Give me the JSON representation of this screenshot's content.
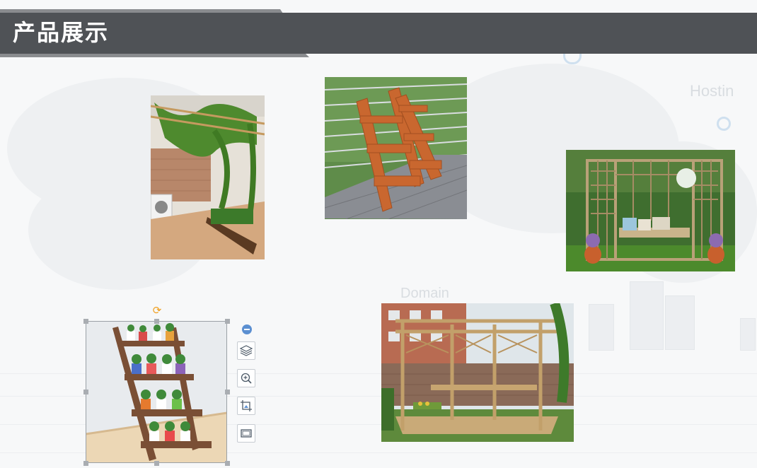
{
  "slide": {
    "title": "产品展示"
  },
  "background": {
    "watermark_hosting": "Hostin",
    "watermark_domain": "Domain"
  },
  "photos": [
    {
      "name": "photo-pergola-balcony",
      "icon": "image-icon"
    },
    {
      "name": "photo-folding-plant-stand",
      "icon": "image-icon"
    },
    {
      "name": "photo-garden-arbor-bench",
      "icon": "image-icon"
    },
    {
      "name": "photo-ladder-plant-shelf",
      "icon": "image-icon",
      "selected": true
    },
    {
      "name": "photo-garden-pavilion",
      "icon": "image-icon"
    }
  ],
  "selection_tools": [
    {
      "name": "layout-options-button",
      "icon": "layers-icon"
    },
    {
      "name": "zoom-button",
      "icon": "zoom-in-icon"
    },
    {
      "name": "crop-button",
      "icon": "crop-icon"
    },
    {
      "name": "frame-button",
      "icon": "frame-icon"
    }
  ],
  "colors": {
    "header": "#4f5256",
    "accent_strip": "#8a8c8f",
    "rotate_handle": "#f0a020",
    "tool_accent": "#5b8fd1"
  }
}
